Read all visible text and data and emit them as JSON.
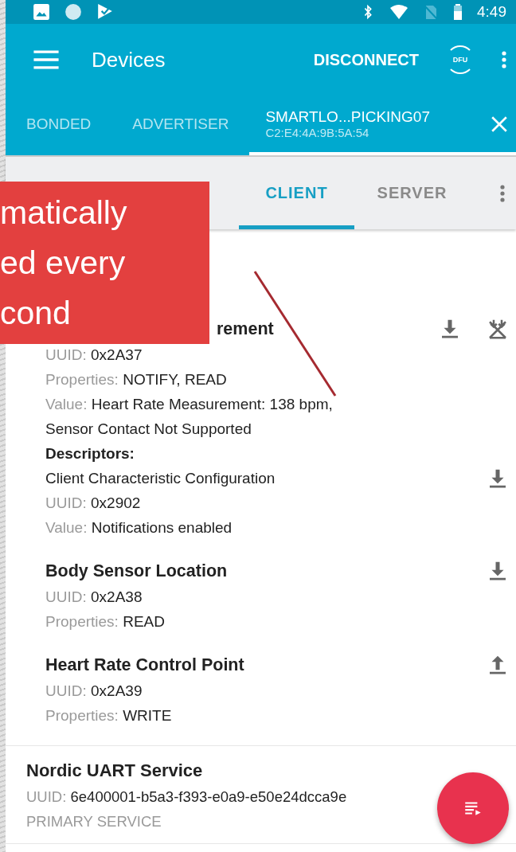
{
  "status_bar": {
    "time": "4:49"
  },
  "toolbar": {
    "title": "Devices",
    "action": "DISCONNECT",
    "dfu_label": "DFU"
  },
  "device_tabs": [
    {
      "label": "BONDED",
      "selected": false
    },
    {
      "label": "ADVERTISER",
      "selected": false
    },
    {
      "label": "SMARTLO...PICKING07",
      "subtitle": "C2:E4:4A:9B:5A:54",
      "selected": true
    }
  ],
  "view_tabs": [
    {
      "label": "CLIENT",
      "selected": true
    },
    {
      "label": "SERVER",
      "selected": false
    }
  ],
  "characteristics": [
    {
      "name": "rement",
      "covered": true,
      "actions": [
        {
          "kind": "read"
        },
        {
          "kind": "notify"
        }
      ],
      "fields": [
        {
          "label": "UUID:",
          "value": "0x2A37"
        },
        {
          "label": "Properties:",
          "value": "NOTIFY, READ"
        },
        {
          "label": "Value:",
          "value": "Heart Rate Measurement: 138 bpm, Sensor Contact Not Supported"
        }
      ],
      "descriptors_label": "Descriptors:",
      "descriptors": [
        {
          "name": "Client Characteristic Configuration",
          "actions": [
            {
              "kind": "read"
            }
          ],
          "fields": [
            {
              "label": "UUID:",
              "value": "0x2902"
            },
            {
              "label": "Value:",
              "value": "Notifications enabled"
            }
          ]
        }
      ]
    },
    {
      "name": "Body Sensor Location",
      "actions": [
        {
          "kind": "read"
        }
      ],
      "fields": [
        {
          "label": "UUID:",
          "value": "0x2A38"
        },
        {
          "label": "Properties:",
          "value": "READ"
        }
      ]
    },
    {
      "name": "Heart Rate Control Point",
      "actions": [
        {
          "kind": "write"
        }
      ],
      "fields": [
        {
          "label": "UUID:",
          "value": "0x2A39"
        },
        {
          "label": "Properties:",
          "value": "WRITE"
        }
      ]
    }
  ],
  "service": {
    "name": "Nordic UART Service",
    "uuid_label": "UUID:",
    "uuid": "6e400001-b5a3-f393-e0a9-e50e24dcca9e",
    "type": "PRIMARY SERVICE"
  },
  "callout": {
    "lines": [
      "matically",
      "ed every",
      "cond"
    ]
  }
}
